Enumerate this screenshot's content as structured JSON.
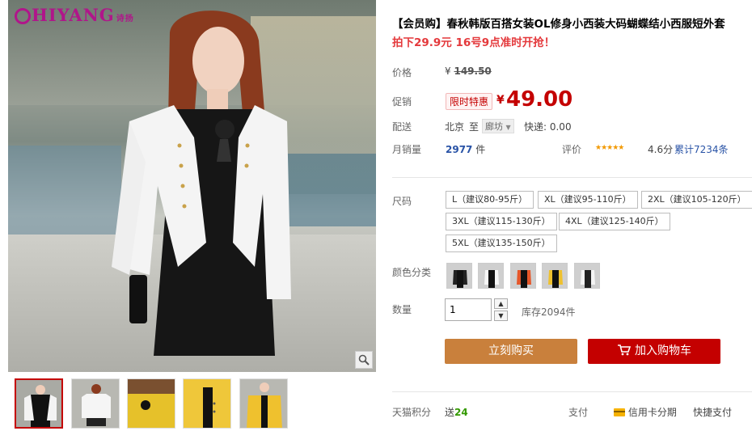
{
  "brand": {
    "logo_text": "HIYANG",
    "logo_sub": "诗扬"
  },
  "product": {
    "title": "【会员购】春秋韩版百搭女装OL修身小西装大码蝴蝶结小西服短外套",
    "promo": "拍下29.9元 16号9点准时开抢！"
  },
  "price": {
    "label": "价格",
    "currency": "¥",
    "original": "149.50"
  },
  "promotion": {
    "label": "促销",
    "tag": "限时特惠",
    "currency": "¥",
    "value": "49.00"
  },
  "delivery": {
    "label": "配送",
    "from": "北京",
    "to_word": "至",
    "destination": "廊坊",
    "express": "快递: 0.00"
  },
  "sales": {
    "label": "月销量",
    "count": "2977",
    "unit": "件",
    "rating_label": "评价",
    "stars": "★★★★★",
    "score": "4.6分",
    "reviews": "累计7234条"
  },
  "size": {
    "label": "尺码",
    "options": [
      "L（建议80-95斤）",
      "XL（建议95-110斤）",
      "2XL（建议105-120斤）",
      "3XL（建议115-130斤）",
      "4XL（建议125-140斤）",
      "5XL（建议135-150斤）"
    ]
  },
  "color": {
    "label": "颜色分类",
    "swatch_count": 5
  },
  "quantity": {
    "label": "数量",
    "value": "1",
    "stock": "库存2094件",
    "up": "▲",
    "down": "▼"
  },
  "actions": {
    "buy_now": "立刻购买",
    "add_to_cart": "加入购物车"
  },
  "footer": {
    "points_label": "天猫积分",
    "points_prefix": "送",
    "points_value": "24",
    "pay_label": "支付",
    "installment": "信用卡分期",
    "quick_pay": "快捷支付"
  },
  "colors": {
    "accent_red": "#c40000",
    "buy_orange": "#c9803c",
    "link_blue": "#2953a6",
    "brand_magenta": "#b0168a"
  }
}
